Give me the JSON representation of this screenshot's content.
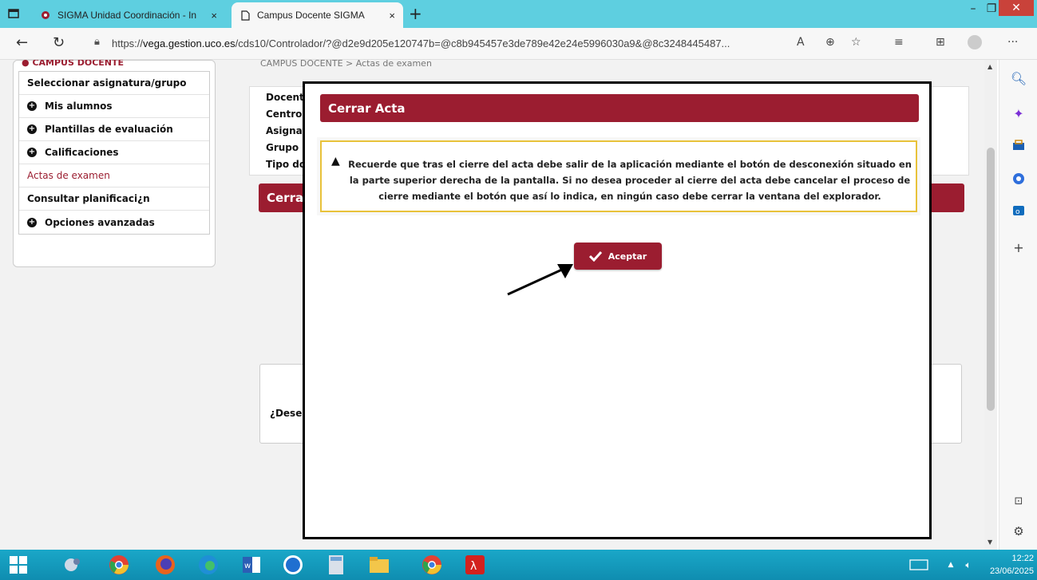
{
  "browser": {
    "tabs": [
      {
        "label": "SIGMA Unidad Coordinación - In",
        "close": "×"
      },
      {
        "label": "Campus Docente SIGMA",
        "close": "×"
      }
    ],
    "new_tab": "+",
    "url_prefix": "https://",
    "url_host": "vega.gestion.uco.es",
    "url_rest": "/cds10/Controlador/?@d2e9d205e120747b=@c8b945457e3de789e42e24e5996030a9&@8c3248445487...",
    "window_min": "–",
    "window_max": "❐",
    "window_close": "✕"
  },
  "sidebar": {
    "header": "CAMPUS DOCENTE",
    "items": [
      {
        "label": "Seleccionar asignatura/grupo",
        "plus": false,
        "red": false
      },
      {
        "label": "Mis alumnos",
        "plus": true,
        "red": false
      },
      {
        "label": "Plantillas de evaluación",
        "plus": true,
        "red": false
      },
      {
        "label": "Calificaciones",
        "plus": true,
        "red": false
      },
      {
        "label": "Actas de examen",
        "plus": false,
        "red": true
      },
      {
        "label": "Consultar planificaci¿n",
        "plus": false,
        "red": false
      },
      {
        "label": "Opciones avanzadas",
        "plus": true,
        "red": false
      }
    ]
  },
  "background": {
    "breadcrumb": "CAMPUS DOCENTE > Actas de examen",
    "info_labels": [
      "Docente",
      "Centro",
      "Asignatu",
      "Grupo",
      "Tipo doc"
    ],
    "banner": "Cerra",
    "question": "¿Desea"
  },
  "modal": {
    "title": "Cerrar Acta",
    "warning": "Recuerde que tras el cierre del acta debe salir de la aplicación mediante el botón de desconexión situado en la parte superior derecha de la pantalla. Si no desea proceder al cierre del acta debe cancelar el proceso de cierre mediante el botón que así lo indica, en ningún caso debe cerrar la ventana del explorador.",
    "accept_label": "Aceptar"
  },
  "taskbar": {
    "time": "12:22",
    "date": "23/06/2025"
  },
  "colors": {
    "accent": "#9b1d30",
    "tabbar": "#5ecfe0",
    "warning_border": "#e8c23a",
    "taskbar": "#1aa7c8"
  }
}
